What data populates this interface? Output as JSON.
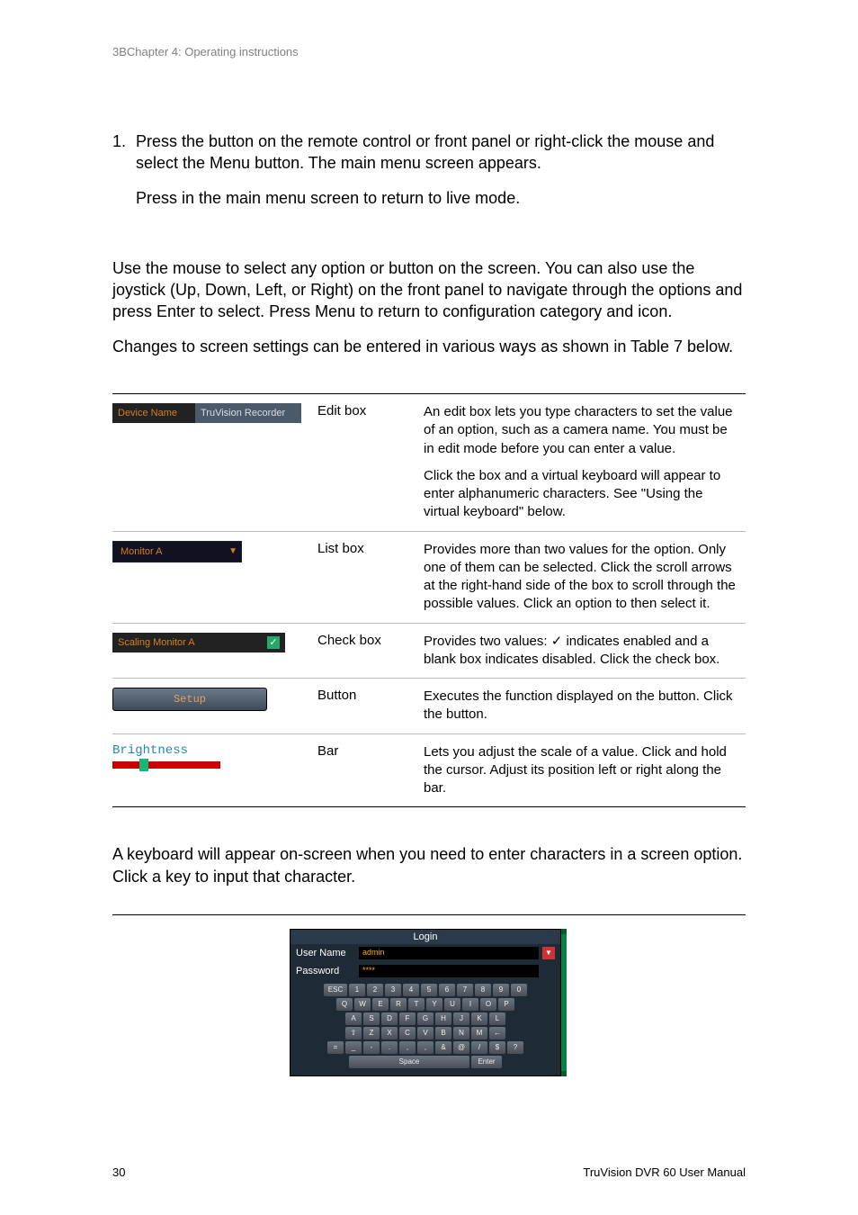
{
  "header": {
    "chapter": "3BChapter 4: Operating instructions"
  },
  "step1": {
    "num": "1.",
    "line1a": "Press the ",
    "line1b": " button on the remote control or front panel or right-click the mouse and select the Menu button. The main menu screen appears.",
    "line2a": "Press ",
    "line2b": " in the main menu screen to return to live mode."
  },
  "nav_para1": "Use the mouse to select any option or button on the screen. You can also use the joystick (Up, Down, Left, or Right) on the front panel to navigate through the options and press Enter to select. Press Menu to return to configuration category and icon.",
  "nav_para2": "Changes to screen settings can be entered in various ways as shown in Table 7 below.",
  "table": [
    {
      "widget": {
        "lbl": "Device Name",
        "val": "TruVision Recorder"
      },
      "name": "Edit box",
      "desc1": "An edit box lets you type characters to set the value of an option, such as a camera name. You must be in edit mode before you can enter a value.",
      "desc2": "Click the box and a virtual keyboard will appear to enter alphanumeric characters. See \"Using the virtual keyboard\" below."
    },
    {
      "widget": {
        "lbl": "Monitor A"
      },
      "name": "List box",
      "desc1": "Provides more than two values for the option. Only one of them can be selected. Click the scroll arrows at the right-hand side of the box to scroll through the possible values. Click an option to then select it."
    },
    {
      "widget": {
        "lbl": "Scaling Monitor A"
      },
      "name": "Check box",
      "desc1": "Provides two values: ✓ indicates enabled and a blank box indicates disabled. Click the check box."
    },
    {
      "widget": {
        "lbl": "Setup"
      },
      "name": "Button",
      "desc1": "Executes the function displayed on the button. Click the button."
    },
    {
      "widget": {
        "lbl": "Brightness"
      },
      "name": "Bar",
      "desc1": "Lets you adjust the scale of a value.  Click and hold the cursor. Adjust its position left or right along the bar."
    }
  ],
  "kb_intro": "A keyboard will appear on-screen when you need to enter characters in a screen option. Click a key to input that character.",
  "login": {
    "title": "Login",
    "user_lbl": "User Name",
    "user_val": "admin",
    "pass_lbl": "Password",
    "pass_val": "****",
    "keys_r1": [
      "ESC",
      "1",
      "2",
      "3",
      "4",
      "5",
      "6",
      "7",
      "8",
      "9",
      "0"
    ],
    "keys_r2": [
      "Q",
      "W",
      "E",
      "R",
      "T",
      "Y",
      "U",
      "I",
      "O",
      "P"
    ],
    "keys_r3": [
      "A",
      "S",
      "D",
      "F",
      "G",
      "H",
      "J",
      "K",
      "L"
    ],
    "keys_r4": [
      "⇧",
      "Z",
      "X",
      "C",
      "V",
      "B",
      "N",
      "M",
      "←"
    ],
    "keys_r5": [
      "=",
      "_",
      "-",
      ".",
      ",",
      ",",
      "&",
      "@",
      "/",
      "$",
      "?"
    ],
    "space": "Space",
    "enter": "Enter"
  },
  "footer": {
    "page": "30",
    "doc": "TruVision DVR 60 User Manual"
  }
}
